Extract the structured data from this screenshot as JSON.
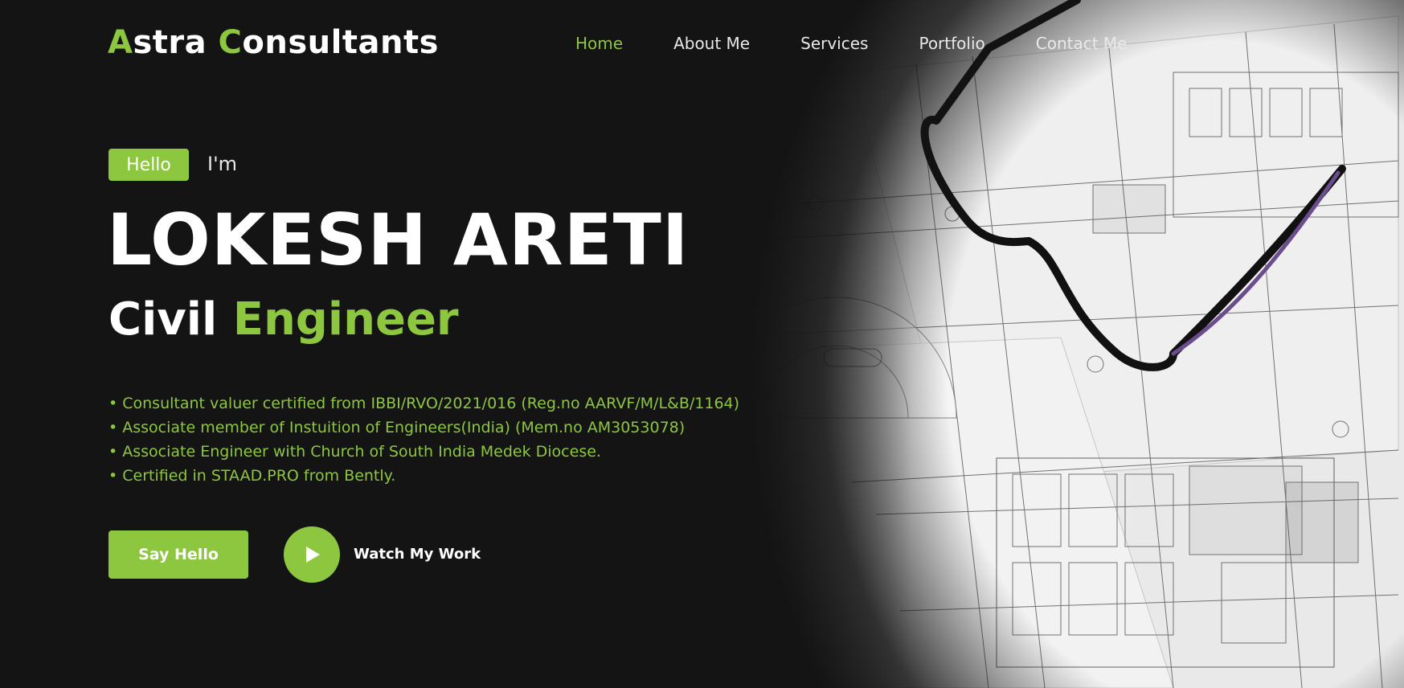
{
  "brand": {
    "first_letter": "A",
    "first_rest": "stra ",
    "second_letter": "C",
    "second_rest": "onsultants"
  },
  "nav": {
    "items": [
      {
        "label": "Home",
        "active": true
      },
      {
        "label": "About Me",
        "active": false
      },
      {
        "label": "Services",
        "active": false
      },
      {
        "label": "Portfolio",
        "active": false
      },
      {
        "label": "Contact Me",
        "active": false
      }
    ]
  },
  "hero": {
    "hello": "Hello",
    "im": "I'm",
    "name": "LOKESH ARETI",
    "role_word1": "Civil",
    "role_word2": "Engineer",
    "bullets": [
      "Consultant valuer certified from IBBI/RVO/2021/016 (Reg.no AARVF/M/L&B/1164)",
      "Associate member of Instuition of Engineers(India) (Mem.no AM3053078)",
      "Associate Engineer with Church of South India Medek Diocese.",
      "Certified in STAAD.PRO from Bently."
    ],
    "say_hello": "Say Hello",
    "watch": "Watch My Work"
  },
  "colors": {
    "accent": "#8dc63f",
    "background": "#141414"
  },
  "icons": {
    "play": "play-icon"
  }
}
